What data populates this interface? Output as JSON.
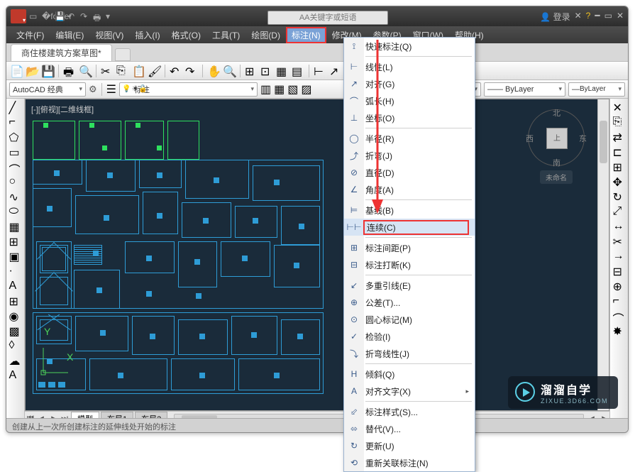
{
  "title": "商住楼建筑方案草图",
  "search_placeholder": "AA关键字或短语",
  "signin": "登录",
  "menubar": [
    "文件(F)",
    "编辑(E)",
    "视图(V)",
    "插入(I)",
    "格式(O)",
    "工具(T)",
    "绘图(D)",
    "标注(N)",
    "修改(M)",
    "参数(P)",
    "窗口(W)",
    "帮助(H)"
  ],
  "menubar_selected_index": 7,
  "doc_tab": "商住楼建筑方案草图*",
  "workspace": "AutoCAD 经典",
  "layer_field": "标注",
  "linetype": "—— ByLayer",
  "bylayer": "ByLayer",
  "view_label": "[-][俯视][二维线框]",
  "navcube": {
    "n": "北",
    "s": "南",
    "e": "东",
    "w": "西",
    "top": "上",
    "unnamed": "未命名"
  },
  "model_tabs": [
    "模型",
    "布局1",
    "布局2"
  ],
  "status_hint": "创建从上一次所创建标注的延伸线处开始的标注",
  "dropdown": {
    "groups": [
      [
        {
          "icon": "⟟",
          "label": "快速标注(Q)"
        }
      ],
      [
        {
          "icon": "⊢",
          "label": "线性(L)"
        },
        {
          "icon": "↗",
          "label": "对齐(G)"
        },
        {
          "icon": "⌒",
          "label": "弧长(H)"
        },
        {
          "icon": "⊥",
          "label": "坐标(O)"
        }
      ],
      [
        {
          "icon": "◯",
          "label": "半径(R)"
        },
        {
          "icon": "⤴",
          "label": "折弯(J)"
        },
        {
          "icon": "⊘",
          "label": "直径(D)"
        },
        {
          "icon": "∠",
          "label": "角度(A)"
        }
      ],
      [
        {
          "icon": "⊨",
          "label": "基线(B)"
        },
        {
          "icon": "⊢⊢",
          "label": "连续(C)",
          "selected": true
        }
      ],
      [
        {
          "icon": "⊞",
          "label": "标注间距(P)"
        },
        {
          "icon": "⊟",
          "label": "标注打断(K)"
        }
      ],
      [
        {
          "icon": "↙",
          "label": "多重引线(E)"
        },
        {
          "icon": "⊕",
          "label": "公差(T)..."
        },
        {
          "icon": "⊙",
          "label": "圆心标记(M)"
        },
        {
          "icon": "✓",
          "label": "检验(I)"
        },
        {
          "icon": "⤵",
          "label": "折弯线性(J)"
        }
      ],
      [
        {
          "icon": "H",
          "label": "倾斜(Q)"
        },
        {
          "icon": "A",
          "label": "对齐文字(X)",
          "submenu": true
        }
      ],
      [
        {
          "icon": "⬃",
          "label": "标注样式(S)..."
        },
        {
          "icon": "⬄",
          "label": "替代(V)..."
        },
        {
          "icon": "↻",
          "label": "更新(U)"
        },
        {
          "icon": "⟲",
          "label": "重新关联标注(N)"
        }
      ]
    ]
  },
  "watermark": {
    "brand": "溜溜自学",
    "url": "ZIXUE.3D66.COM"
  }
}
